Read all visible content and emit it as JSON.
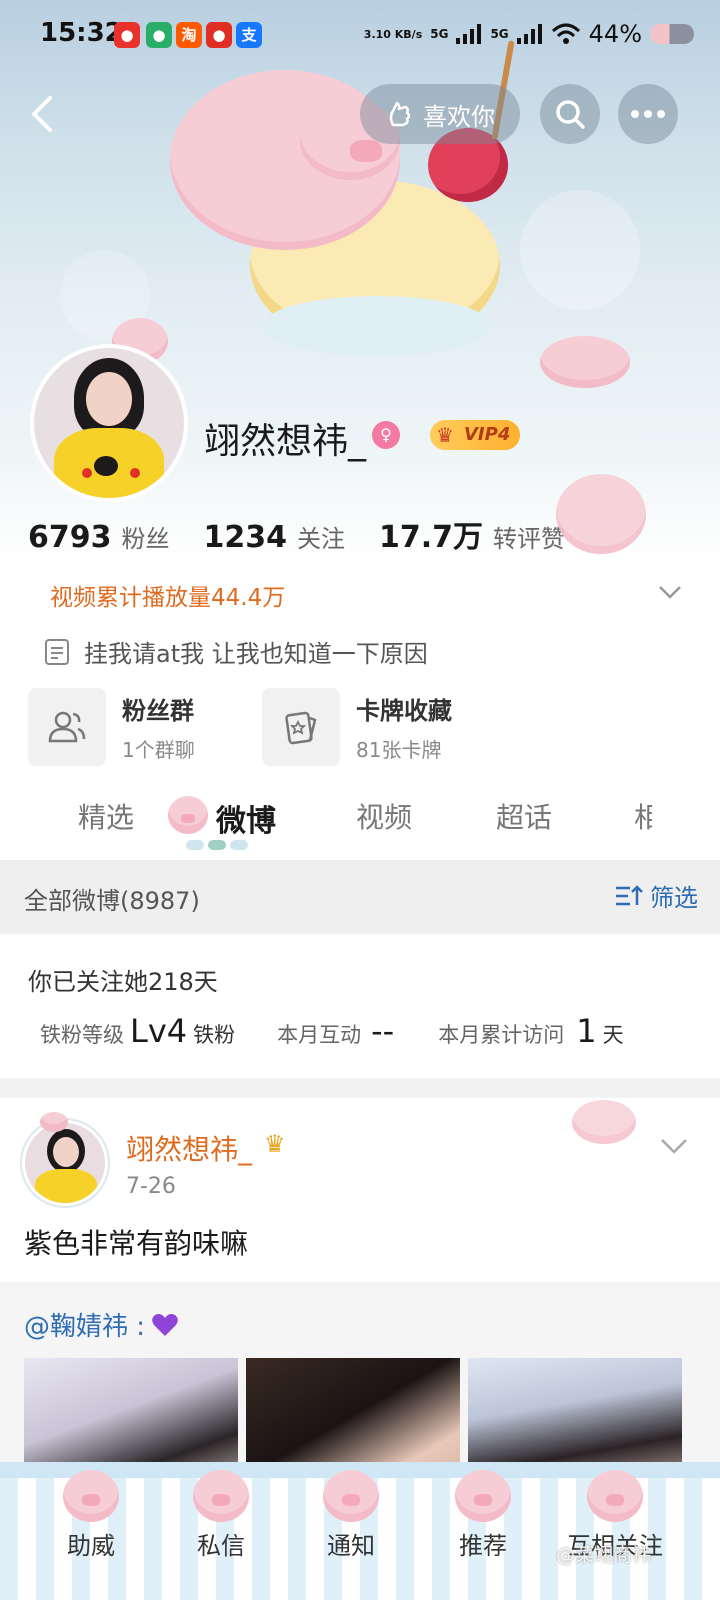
{
  "status_bar": {
    "time": "15:32",
    "apps": [
      "weibo",
      "wechat",
      "taobao",
      "pinduoduo",
      "alipay"
    ],
    "net_speed": "3.10 KB/s",
    "signal_1": "5G",
    "signal_2": "5G",
    "battery": "44%"
  },
  "nav": {
    "like_label": "喜欢你"
  },
  "profile": {
    "username": "翊然想祎_",
    "vip_label": "VIP4",
    "stats": [
      {
        "num": "6793",
        "label": "粉丝"
      },
      {
        "num": "1234",
        "label": "关注"
      },
      {
        "num": "17.7万",
        "label": "转评赞"
      }
    ],
    "video_plays": "视频累计播放量44.4万",
    "bio": "挂我请at我 让我也知道一下原因",
    "features": [
      {
        "title": "粉丝群",
        "sub": "1个群聊"
      },
      {
        "title": "卡牌收藏",
        "sub": "81张卡牌"
      }
    ]
  },
  "tabs": [
    "精选",
    "微博",
    "视频",
    "超话",
    "相"
  ],
  "list_header": {
    "all_weibo": "全部微博(8987)",
    "filter_label": "筛选"
  },
  "follow": {
    "days": "你已关注她218天",
    "level_label": "铁粉等级",
    "level_value": "Lv4",
    "level_suffix": "铁粉",
    "interact_label": "本月互动",
    "interact_value": "--",
    "visit_label": "本月累计访问",
    "visit_value": "1",
    "visit_suffix": "天"
  },
  "post": {
    "author": "翊然想祎_",
    "date": "7-26",
    "text": "紫色非常有韵味嘛",
    "mention": "@鞠婧祎 :"
  },
  "bottom_tabs": [
    "助威",
    "私信",
    "通知",
    "推荐",
    "互相关注"
  ],
  "watermark": "@菜翊商祎",
  "colors": {
    "accent_orange": "#e06b1f",
    "link_blue": "#2e6db3",
    "vip_gold": "#ffb02e",
    "pig_pink": "#f6cdd4"
  }
}
